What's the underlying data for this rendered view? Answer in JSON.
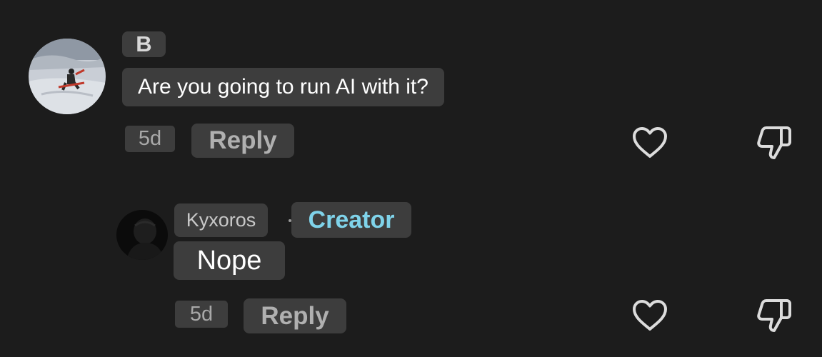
{
  "comments": [
    {
      "author": "B",
      "text": "Are you going to run AI with it?",
      "age": "5d",
      "reply_label": "Reply"
    },
    {
      "author": "Kyxoros",
      "badge": "Creator",
      "text": "Nope",
      "age": "5d",
      "reply_label": "Reply"
    }
  ],
  "colors": {
    "background": "#1c1c1c",
    "chip": "#3d3d3d",
    "creator_badge": "#7fd3ea",
    "muted_text": "#b8b8b8",
    "icon": "#dcdcdc"
  },
  "icons": [
    "avatar-snow-icon",
    "avatar-dark-icon",
    "heart-icon",
    "thumbs-down-icon"
  ]
}
